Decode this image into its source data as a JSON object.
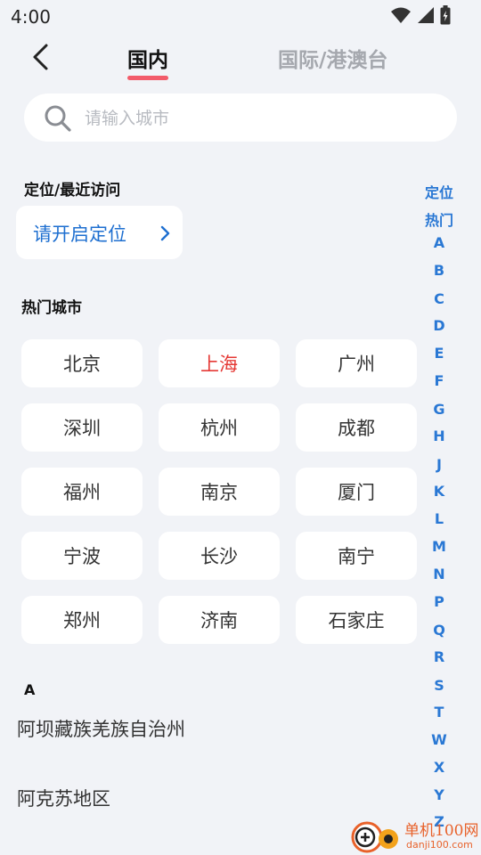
{
  "status": {
    "time": "4:00"
  },
  "tabs": [
    {
      "label": "国内",
      "active": true
    },
    {
      "label": "国际/港澳台",
      "active": false
    }
  ],
  "search": {
    "placeholder": "请输入城市",
    "value": ""
  },
  "location": {
    "section_title": "定位/最近访问",
    "button_label": "请开启定位",
    "icon": "chevron-right-icon"
  },
  "hot": {
    "section_title": "热门城市",
    "cities": [
      {
        "name": "北京",
        "active": false
      },
      {
        "name": "上海",
        "active": true
      },
      {
        "name": "广州",
        "active": false
      },
      {
        "name": "深圳",
        "active": false
      },
      {
        "name": "杭州",
        "active": false
      },
      {
        "name": "成都",
        "active": false
      },
      {
        "name": "福州",
        "active": false
      },
      {
        "name": "南京",
        "active": false
      },
      {
        "name": "厦门",
        "active": false
      },
      {
        "name": "宁波",
        "active": false
      },
      {
        "name": "长沙",
        "active": false
      },
      {
        "name": "南宁",
        "active": false
      },
      {
        "name": "郑州",
        "active": false
      },
      {
        "name": "济南",
        "active": false
      },
      {
        "name": "石家庄",
        "active": false
      }
    ]
  },
  "list": {
    "letter": "A",
    "cities": [
      "阿坝藏族羌族自治州",
      "阿克苏地区"
    ]
  },
  "index": [
    "定位",
    "热门",
    "A",
    "B",
    "C",
    "D",
    "E",
    "F",
    "G",
    "H",
    "J",
    "K",
    "L",
    "M",
    "N",
    "P",
    "Q",
    "R",
    "S",
    "T",
    "W",
    "X",
    "Y",
    "Z"
  ],
  "watermark": {
    "title": "单机100网",
    "url": "danji100.com"
  },
  "colors": {
    "accent": "#2a78d4",
    "tab_indicator": "#f25b6a",
    "active_city": "#e53935",
    "watermark": "#e8612a"
  }
}
